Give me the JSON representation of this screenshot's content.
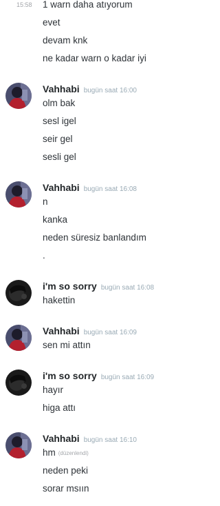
{
  "continuation": {
    "time": "15:58",
    "lines": [
      "1 warn daha atıyorum",
      "evet",
      "devam knk",
      "ne kadar warn o kadar iyi"
    ]
  },
  "groups": [
    {
      "username": "Vahhabi",
      "timestamp": "bugün saat 16:00",
      "avatar": "vahhabi-avatar",
      "messages": [
        {
          "text": "olm bak",
          "edited": ""
        },
        {
          "text": "sesl igel",
          "edited": ""
        },
        {
          "text": "seir gel",
          "edited": ""
        },
        {
          "text": "sesli gel",
          "edited": ""
        }
      ]
    },
    {
      "username": "Vahhabi",
      "timestamp": "bugün saat 16:08",
      "avatar": "vahhabi-avatar",
      "messages": [
        {
          "text": "n",
          "edited": ""
        },
        {
          "text": "kanka",
          "edited": ""
        },
        {
          "text": "neden süresiz banlandım",
          "edited": ""
        },
        {
          "text": ".",
          "edited": ""
        }
      ]
    },
    {
      "username": "i'm so sorry",
      "timestamp": "bugün saat 16:08",
      "avatar": "sorry-avatar",
      "messages": [
        {
          "text": "hakettin",
          "edited": ""
        }
      ]
    },
    {
      "username": "Vahhabi",
      "timestamp": "bugün saat 16:09",
      "avatar": "vahhabi-avatar",
      "messages": [
        {
          "text": "sen mi attın",
          "edited": ""
        }
      ]
    },
    {
      "username": "i'm so sorry",
      "timestamp": "bugün saat 16:09",
      "avatar": "sorry-avatar",
      "messages": [
        {
          "text": "hayır",
          "edited": ""
        },
        {
          "text": "higa attı",
          "edited": ""
        }
      ]
    },
    {
      "username": "Vahhabi",
      "timestamp": "bugün saat 16:10",
      "avatar": "vahhabi-avatar",
      "messages": [
        {
          "text": "hm",
          "edited": "(düzenlendi)"
        },
        {
          "text": "neden peki",
          "edited": ""
        },
        {
          "text": "sorar msıın",
          "edited": ""
        }
      ]
    }
  ]
}
